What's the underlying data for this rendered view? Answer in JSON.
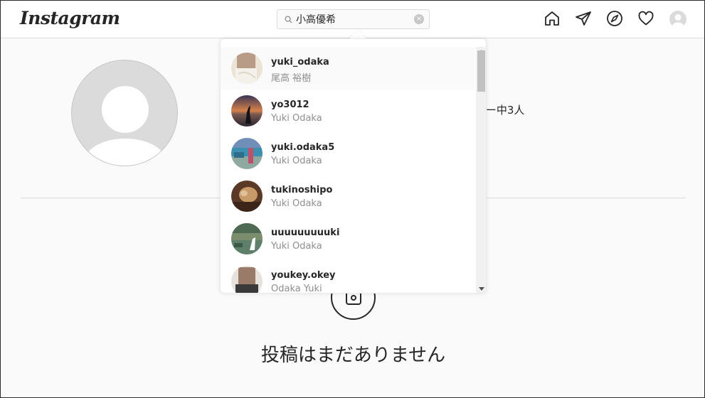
{
  "header": {
    "logo": "Instagram",
    "search": {
      "value": "小高優希",
      "clear_label": "×"
    }
  },
  "profile": {
    "stat_fragment": "]ー中3人"
  },
  "posts": {
    "empty_message": "投稿はまだありません"
  },
  "dropdown": {
    "results": [
      {
        "username": "yuki_odaka",
        "full_name": "尾高 裕樹",
        "photo": "blurred"
      },
      {
        "username": "yo3012",
        "full_name": "Yuki Odaka",
        "photo": "sunset"
      },
      {
        "username": "yuki.odaka5",
        "full_name": "Yuki Odaka",
        "photo": "beach"
      },
      {
        "username": "tukinoshipo",
        "full_name": "Yuki Odaka",
        "photo": "brown"
      },
      {
        "username": "uuuuuuuuuki",
        "full_name": "Yuki Odaka",
        "photo": "field"
      },
      {
        "username": "youkey.okey",
        "full_name": "Odaka Yuki",
        "photo": "blurred-dark"
      }
    ]
  },
  "colors": {
    "border": "#dbdbdb",
    "text": "#262626",
    "muted": "#8e8e8e",
    "background": "#fafafa"
  }
}
